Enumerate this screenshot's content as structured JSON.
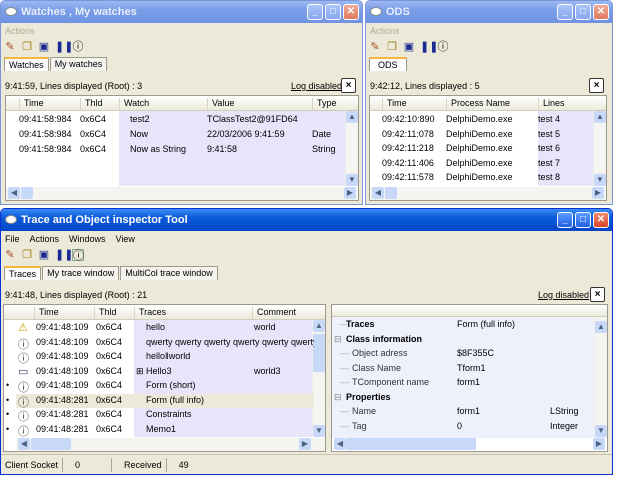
{
  "watches": {
    "title": "Watches , My watches",
    "menu": [
      "Actions"
    ],
    "tabs": [
      "Watches",
      "My watches"
    ],
    "status": "9:41:59, Lines displayed (Root) : 3",
    "log_label": "Log disabled",
    "close_x": "×",
    "columns": [
      "Time",
      "Thld",
      "Watch",
      "Value",
      "Type"
    ],
    "rows": [
      [
        "09:41:58:984",
        "0x6C4",
        "test2",
        "TClassTest2@91FD64",
        ""
      ],
      [
        "09:41:58:984",
        "0x6C4",
        "Now",
        "22/03/2006 9:41:59",
        "Date"
      ],
      [
        "09:41:58:984",
        "0x6C4",
        "Now as String",
        "9:41:58",
        "String"
      ]
    ]
  },
  "ods": {
    "title": "ODS",
    "menu": [
      "Actions"
    ],
    "tabs": [
      "ODS"
    ],
    "status": "9:42:12, Lines displayed : 5",
    "close_x": "×",
    "columns": [
      "Time",
      "Process Name",
      "Lines"
    ],
    "rows": [
      [
        "09:42:10:890",
        "DelphiDemo.exe",
        "test 4"
      ],
      [
        "09:42:11:078",
        "DelphiDemo.exe",
        "test 5"
      ],
      [
        "09:42:11:218",
        "DelphiDemo.exe",
        "test 6"
      ],
      [
        "09:42:11:406",
        "DelphiDemo.exe",
        "test 7"
      ],
      [
        "09:42:11:578",
        "DelphiDemo.exe",
        "test 8"
      ]
    ]
  },
  "trace": {
    "title": "Trace and Object inspector Tool",
    "menu": [
      "File",
      "Actions",
      "Windows",
      "View"
    ],
    "tabs": [
      "Traces",
      "My trace window",
      "MultiCol trace window"
    ],
    "status": "9:41:48, Lines displayed (Root) : 21",
    "log_label": "Log disabled",
    "close_x": "×",
    "columns": [
      "Time",
      "Thld",
      "Traces",
      "Comment"
    ],
    "rows": [
      {
        "icon": "warning",
        "time": "09:41:48:109",
        "thid": "0x6C4",
        "trace": "hello",
        "comment": "world",
        "dot": false
      },
      {
        "icon": "info",
        "time": "09:41:48:109",
        "thid": "0x6C4",
        "trace": "qwerty  qwerty qwerty qwerty qwerty qwerty",
        "comment": "",
        "dot": false
      },
      {
        "icon": "info",
        "time": "09:41:48:109",
        "thid": "0x6C4",
        "trace": "hello‖world",
        "comment": "",
        "dot": false
      },
      {
        "icon": "window",
        "time": "09:41:48:109",
        "thid": "0x6C4",
        "trace": "Hello3",
        "comment": "world3",
        "dot": false,
        "expand": "⊞"
      },
      {
        "icon": "info",
        "time": "09:41:48:109",
        "thid": "0x6C4",
        "trace": "Form (short)",
        "comment": "",
        "dot": true
      },
      {
        "icon": "info",
        "time": "09:41:48:281",
        "thid": "0x6C4",
        "trace": "Form (full info)",
        "comment": "",
        "dot": true,
        "selected": true
      },
      {
        "icon": "info",
        "time": "09:41:48:281",
        "thid": "0x6C4",
        "trace": "Constraints",
        "comment": "",
        "dot": true
      },
      {
        "icon": "info",
        "time": "09:41:48:281",
        "thid": "0x6C4",
        "trace": "Memo1",
        "comment": "",
        "dot": true
      }
    ],
    "inspector": [
      {
        "level": 1,
        "bold": true,
        "name": "Traces",
        "value": "Form (full info)",
        "type": ""
      },
      {
        "level": 0,
        "bold": true,
        "name": "Class information",
        "value": "",
        "type": "",
        "toggle": "⊟"
      },
      {
        "level": 1,
        "bold": false,
        "name": "Object adress",
        "value": "$8F355C",
        "type": ""
      },
      {
        "level": 1,
        "bold": false,
        "name": "Class Name",
        "value": "Tform1",
        "type": ""
      },
      {
        "level": 1,
        "bold": false,
        "name": "TComponent name",
        "value": "form1",
        "type": ""
      },
      {
        "level": 0,
        "bold": true,
        "name": "Properties",
        "value": "",
        "type": "",
        "toggle": "⊟"
      },
      {
        "level": 1,
        "bold": false,
        "name": "Name",
        "value": "form1",
        "type": "LString"
      },
      {
        "level": 1,
        "bold": false,
        "name": "Tag",
        "value": "0",
        "type": "Integer"
      }
    ],
    "statusbar": {
      "client_label": "Client Socket",
      "client_value": "0",
      "received_label": "Received",
      "received_value": "49"
    }
  },
  "colors": {
    "lavender": "#e6e5fa",
    "selected": "#ece9d8",
    "titlebar": "#0a5ad8"
  }
}
